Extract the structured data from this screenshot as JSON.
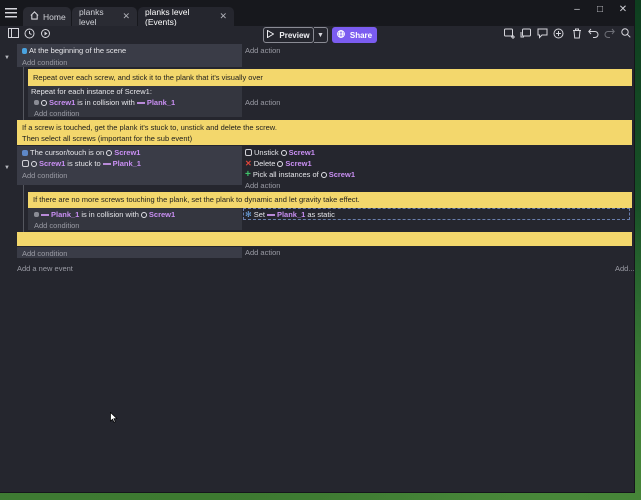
{
  "tabs": [
    {
      "label": "Home",
      "icon": "home-icon"
    },
    {
      "label": "planks level",
      "icon": ""
    },
    {
      "label": "planks level (Events)",
      "icon": ""
    }
  ],
  "window_controls": {
    "minimize": "–",
    "maximize": "□",
    "close": "✕"
  },
  "toolbar": {
    "preview_label": "Preview",
    "share_label": "Share",
    "accent": "#7b5cf0"
  },
  "events": {
    "ev1": {
      "condition": "At the beginning of the scene",
      "add_condition": "Add condition",
      "add_action": "Add action"
    },
    "comment1": "Repeat over each screw, and stick it to the plank that it's visually over",
    "repeat_header": "Repeat for each instance of Screw1:",
    "ev2": {
      "obj1": "Screw1",
      "text": "is in collision with",
      "obj2": "Plank_1",
      "add_condition": "Add condition",
      "add_action": "Add action"
    },
    "comment2_line1": "If a screw is touched, get the plank it's stuck to, unstick and delete the screw.",
    "comment2_line2": "Then select all screws (important for the sub event)",
    "ev3": {
      "cond1_text": "The cursor/touch is on",
      "cond1_obj": "Screw1",
      "cond2_obj": "Screw1",
      "cond2_text": "is stuck to",
      "cond2_obj2": "Plank_1",
      "add_condition": "Add condition",
      "act1_text": "Unstick",
      "act1_obj": "Screw1",
      "act2_text": "Delete",
      "act2_obj": "Screw1",
      "act3_text": "Pick all instances of",
      "act3_obj": "Screw1",
      "add_action": "Add action"
    },
    "comment3": "If there are no more screws touching the plank, set the plank to dynamic and let gravity take effect.",
    "ev4": {
      "cond_obj": "Plank_1",
      "cond_text": "is in collision with",
      "cond_obj2": "Screw1",
      "add_condition": "Add condition",
      "act_text": "Set",
      "act_obj": "Plank_1",
      "act_text2": "as static"
    },
    "ev5": {
      "add_condition": "Add condition",
      "add_action": "Add action"
    },
    "add_new_event": "Add a new event",
    "add_more": "Add..."
  }
}
